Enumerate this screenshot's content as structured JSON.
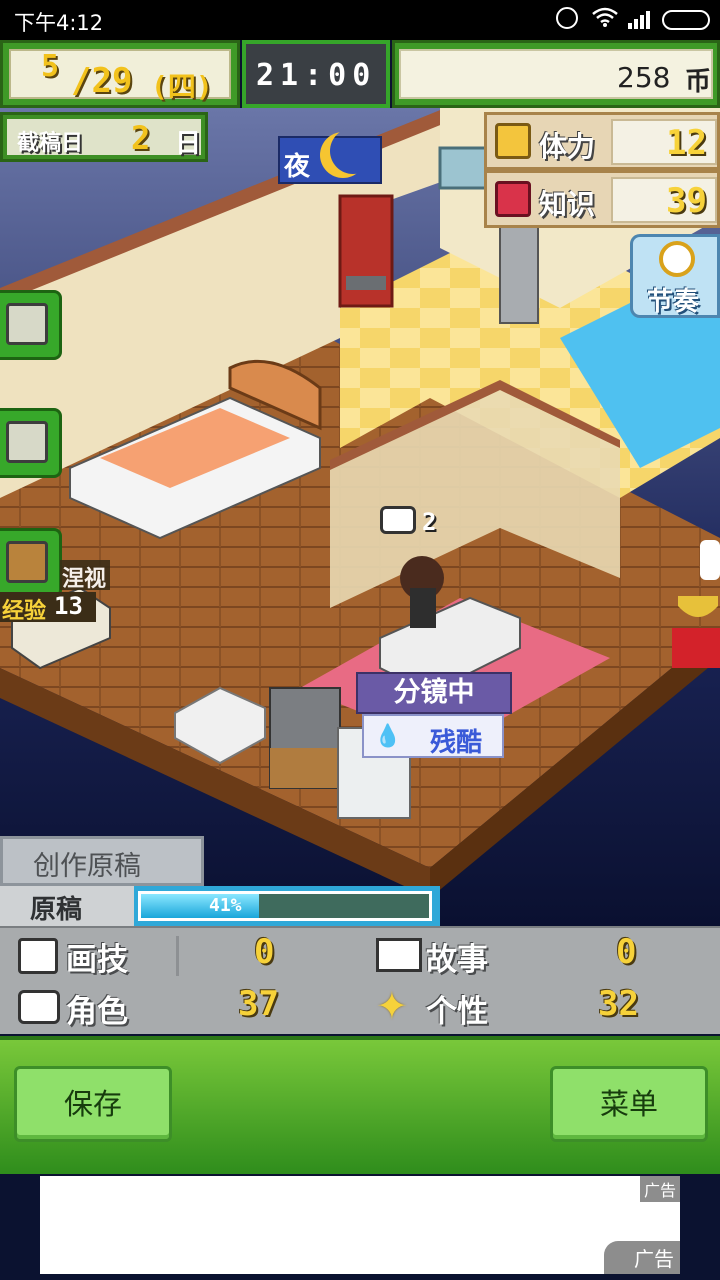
{
  "status_bar": {
    "time": "下午4:12"
  },
  "top_bar": {
    "month": "5",
    "day": "/29",
    "weekday": "(四)",
    "clock": "21:00",
    "money_value": "258",
    "money_unit": "币"
  },
  "deadline": {
    "label": "截稿日",
    "value": "2",
    "unit": "日"
  },
  "time_of_day": "夜",
  "stats_top": [
    {
      "label": "体力",
      "value": "12"
    },
    {
      "label": "知识",
      "value": "39"
    }
  ],
  "rhythm_button": {
    "label": "节奏"
  },
  "room": {
    "speech_count": "2",
    "visitor_label": "涅视",
    "exp_label": "经验",
    "exp_value": "13",
    "activity_label": "分镜中",
    "mood_label": "残酷"
  },
  "draft": {
    "tab_label": "创作原稿",
    "label": "原稿",
    "progress_text": "41%",
    "progress": 41
  },
  "stats": [
    {
      "label": "画技",
      "value": "0",
      "icon": "brush-icon"
    },
    {
      "label": "故事",
      "value": "0",
      "icon": "book-icon"
    },
    {
      "label": "角色",
      "value": "37",
      "icon": "speech-bubble-icon"
    },
    {
      "label": "个性",
      "value": "32",
      "icon": "sparkle-icon"
    }
  ],
  "buttons": {
    "save": "保存",
    "menu": "菜单"
  },
  "ad": {
    "label": "广告",
    "label2": "广告"
  },
  "colors": {
    "accent_green": "#4aa72b",
    "gold": "#f7d23a",
    "night_bg": "#0b1230"
  }
}
